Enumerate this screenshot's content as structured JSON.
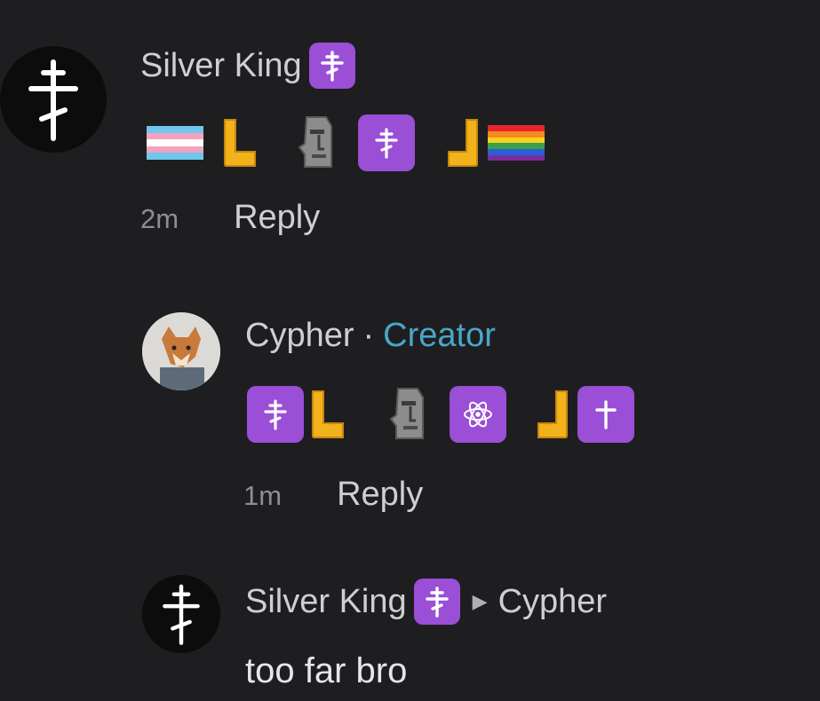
{
  "comments": [
    {
      "username": "Silver King",
      "badge_icon": "orthodox-cross-icon",
      "emoji_sequence": [
        "transgender-flag-icon",
        "thumb-l-icon",
        "moai-icon",
        "orthodox-cross-badge-icon",
        "thumb-j-icon",
        "rainbow-flag-icon"
      ],
      "time": "2m",
      "reply_label": "Reply"
    },
    {
      "username": "Cypher",
      "separator": "·",
      "role": "Creator",
      "emoji_sequence": [
        "orthodox-cross-badge-icon",
        "thumb-l-icon",
        "moai-icon",
        "atom-badge-icon",
        "thumb-j-icon",
        "latin-cross-badge-icon"
      ],
      "time": "1m",
      "reply_label": "Reply"
    },
    {
      "username": "Silver King",
      "badge_icon": "orthodox-cross-icon",
      "reply_to": "Cypher",
      "text": "too far bro"
    }
  ],
  "colors": {
    "background": "#1e1e20",
    "badge_purple": "#9a4fd6",
    "creator_blue": "#4aa6c8",
    "muted_text": "#8d8d92"
  }
}
